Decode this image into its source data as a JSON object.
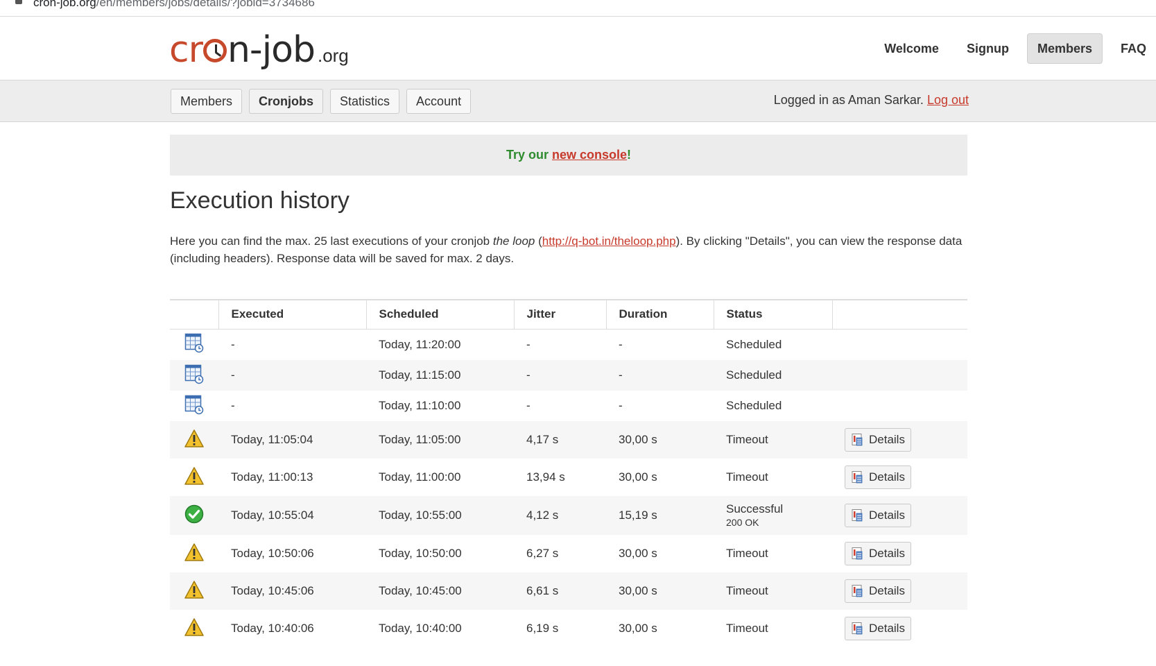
{
  "browser": {
    "url_host": "cron-job.org",
    "url_path": "/en/members/jobs/details/?jobid=3734686"
  },
  "header": {
    "logo_left": "cr",
    "logo_mid": "n-job",
    "logo_tld": ".org",
    "nav": [
      {
        "label": "Welcome",
        "active": false
      },
      {
        "label": "Signup",
        "active": false
      },
      {
        "label": "Members",
        "active": true
      },
      {
        "label": "FAQ",
        "active": false
      }
    ]
  },
  "subnav": {
    "tabs": [
      {
        "label": "Members",
        "active": false
      },
      {
        "label": "Cronjobs",
        "active": true
      },
      {
        "label": "Statistics",
        "active": false
      },
      {
        "label": "Account",
        "active": false
      }
    ],
    "logged_in_text": "Logged in as Aman Sarkar.",
    "logout_label": "Log out"
  },
  "banner": {
    "prefix": "Try our ",
    "link": "new console",
    "suffix": "!"
  },
  "page": {
    "title": "Execution history",
    "intro_1": "Here you can find the max. 25 last executions of your cronjob ",
    "intro_job": "the loop",
    "intro_2": " (",
    "intro_link": "http://q-bot.in/theloop.php",
    "intro_3": "). By clicking \"Details\", you can view the response data (including headers). Response data will be saved for max. 2 days."
  },
  "table": {
    "headers": [
      "",
      "Executed",
      "Scheduled",
      "Jitter",
      "Duration",
      "Status",
      ""
    ],
    "details_label": "Details",
    "rows": [
      {
        "icon": "scheduled-icon",
        "executed": "-",
        "scheduled": "Today, 11:20:00",
        "jitter": "-",
        "duration": "-",
        "status": "Scheduled",
        "status_sub": "",
        "details": false
      },
      {
        "icon": "scheduled-icon",
        "executed": "-",
        "scheduled": "Today, 11:15:00",
        "jitter": "-",
        "duration": "-",
        "status": "Scheduled",
        "status_sub": "",
        "details": false
      },
      {
        "icon": "scheduled-icon",
        "executed": "-",
        "scheduled": "Today, 11:10:00",
        "jitter": "-",
        "duration": "-",
        "status": "Scheduled",
        "status_sub": "",
        "details": false
      },
      {
        "icon": "warning-icon",
        "executed": "Today, 11:05:04",
        "scheduled": "Today, 11:05:00",
        "jitter": "4,17 s",
        "duration": "30,00 s",
        "status": "Timeout",
        "status_sub": "",
        "details": true
      },
      {
        "icon": "warning-icon",
        "executed": "Today, 11:00:13",
        "scheduled": "Today, 11:00:00",
        "jitter": "13,94 s",
        "duration": "30,00 s",
        "status": "Timeout",
        "status_sub": "",
        "details": true
      },
      {
        "icon": "success-icon",
        "executed": "Today, 10:55:04",
        "scheduled": "Today, 10:55:00",
        "jitter": "4,12 s",
        "duration": "15,19 s",
        "status": "Successful",
        "status_sub": "200 OK",
        "details": true
      },
      {
        "icon": "warning-icon",
        "executed": "Today, 10:50:06",
        "scheduled": "Today, 10:50:00",
        "jitter": "6,27 s",
        "duration": "30,00 s",
        "status": "Timeout",
        "status_sub": "",
        "details": true
      },
      {
        "icon": "warning-icon",
        "executed": "Today, 10:45:06",
        "scheduled": "Today, 10:45:00",
        "jitter": "6,61 s",
        "duration": "30,00 s",
        "status": "Timeout",
        "status_sub": "",
        "details": true
      },
      {
        "icon": "warning-icon",
        "executed": "Today, 10:40:06",
        "scheduled": "Today, 10:40:00",
        "jitter": "6,19 s",
        "duration": "30,00 s",
        "status": "Timeout",
        "status_sub": "",
        "details": true
      }
    ]
  },
  "colors": {
    "accent_red": "#c7392b",
    "banner_green": "#2e8b2e",
    "warning_yellow": "#f2c12e",
    "success_green": "#3cb043"
  }
}
